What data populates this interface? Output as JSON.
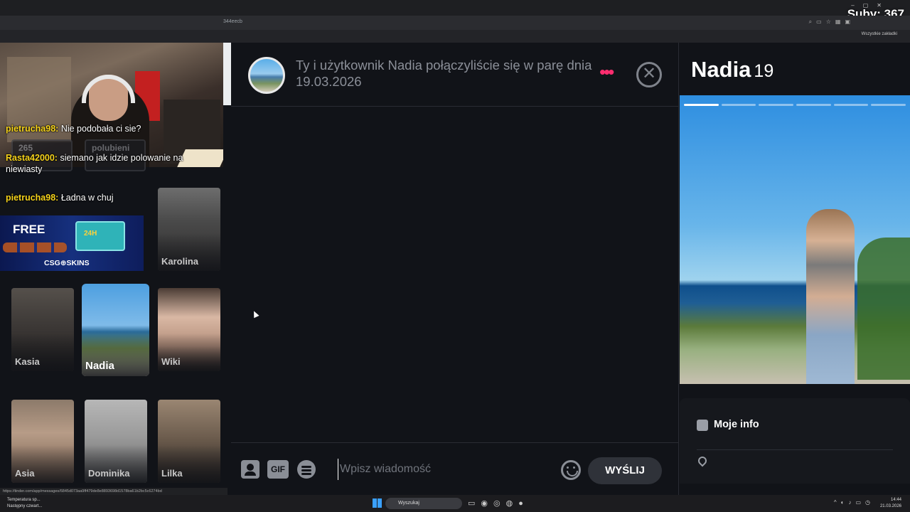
{
  "browser": {
    "url_fragment": "344eecb",
    "bookmarks_label": "Wszystkie zakładki",
    "status_url": "https://tinder.com/app/messages/6845d073aa9ff479de8e8893698d1578ba61b2bc5c6274bd"
  },
  "stream": {
    "subs_label": "Suby: 367",
    "chat": [
      {
        "user": "pietrucha98:",
        "text": " Nie podobała ci sie?"
      },
      {
        "user": "Rasta42000:",
        "text": " siemano jak idzie polowanie na niewiasty"
      },
      {
        "user": "pietrucha98:",
        "text": " Ładna w chuj"
      }
    ],
    "ad": {
      "free": "FREE",
      "case_label": "24H",
      "brand": "CSG⊕SKINS"
    }
  },
  "matches": {
    "faded_counts": [
      "265",
      "polubieni"
    ],
    "cards": [
      {
        "name": "Karolina"
      },
      {
        "name": "Kasia"
      },
      {
        "name": "Nadia"
      },
      {
        "name": "Wiki"
      },
      {
        "name": "Asia"
      },
      {
        "name": "Dominika"
      },
      {
        "name": "Lilka"
      }
    ]
  },
  "conversation": {
    "header_text": "Ty i użytkownik Nadia połączyliście się w parę dnia 19.03.2026",
    "more_icon": "more-dots-icon",
    "close_icon": "close-circle-icon",
    "accent_color": "#ff2d6f",
    "gif_label": "GIF",
    "input_placeholder": "Wpisz wiadomość",
    "send_label": "WYŚLIJ"
  },
  "profile": {
    "name": "Nadia",
    "age": "19",
    "photo_count": 6,
    "photo_active_index": 0,
    "info_title": "Moje info"
  },
  "taskbar": {
    "weather_line1": "Temperatura sp...",
    "weather_line2": "Następny czwart...",
    "search_label": "Wyszukaj",
    "time": "14:44",
    "date": "21.03.2026"
  }
}
